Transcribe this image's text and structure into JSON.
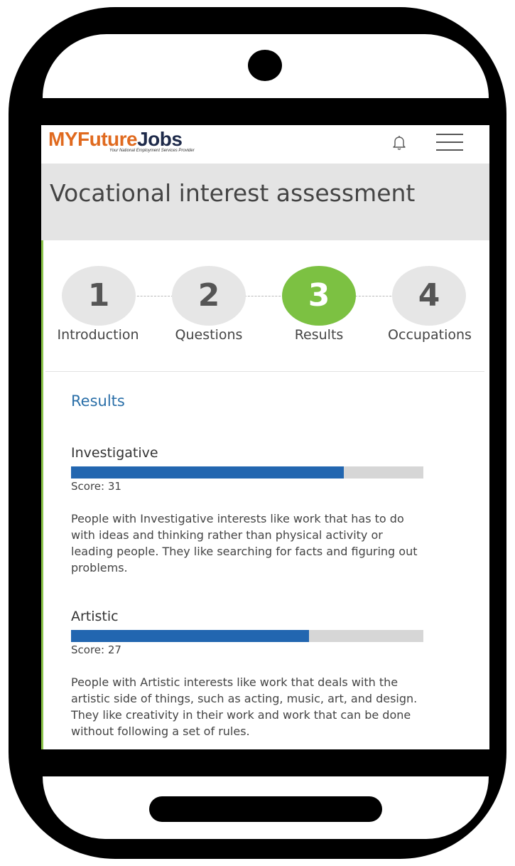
{
  "app": {
    "logo_part_my": "MY",
    "logo_part_future": "Future",
    "logo_part_jobs": "Jobs",
    "tagline": "Your National Employment Services Provider"
  },
  "icons": {
    "bell": "bell-icon",
    "menu": "hamburger-menu-icon"
  },
  "colors": {
    "brand_orange": "#e06a1f",
    "brand_navy": "#1e2a4a",
    "active_step": "#7cc142",
    "bar_fill": "#2266b0",
    "heading_blue": "#2a6fa8"
  },
  "page": {
    "title": "Vocational interest assessment"
  },
  "stepper": {
    "steps": [
      {
        "number": "1",
        "label": "Introduction",
        "active": false
      },
      {
        "number": "2",
        "label": "Questions",
        "active": false
      },
      {
        "number": "3",
        "label": "Results",
        "active": true
      },
      {
        "number": "4",
        "label": "Occupations",
        "active": false
      }
    ]
  },
  "results": {
    "heading": "Results",
    "items": [
      {
        "name": "Investigative",
        "score_text": "Score: 31",
        "fill_fraction": 0.775,
        "description": "People with Investigative interests like work that has to do with ideas and thinking rather than physical activity or leading people. They like searching for facts and figuring out problems."
      },
      {
        "name": "Artistic",
        "score_text": "Score: 27",
        "fill_fraction": 0.675,
        "description": "People with Artistic interests like work that deals with the artistic side of things, such as acting, music, art, and design. They like creativity in their work and work that can be done without following a set of rules."
      }
    ]
  }
}
